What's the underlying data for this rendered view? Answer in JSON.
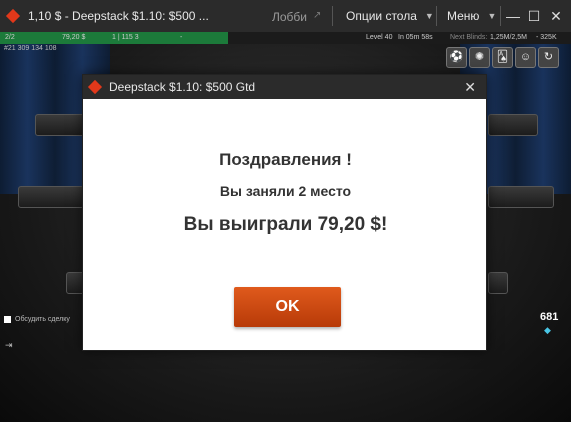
{
  "window": {
    "title": "1,10 $ - Deepstack $1.10: $500 ...",
    "lobby_label": "Лобби",
    "table_options_label": "Опции стола",
    "menu_label": "Меню"
  },
  "status": {
    "players": "2/2",
    "stack": "79,20 $",
    "level_info": "1 | 115 3",
    "plus": "-",
    "level": "Level 40",
    "time": "In 05m 58s",
    "next_blinds": "Next Blinds:",
    "blinds_value": "1,25M/2,5M",
    "ante": "- 325K",
    "hand_id": "#21 309 134 108"
  },
  "table": {
    "chat_label": "Обсудить сделку",
    "score": "681"
  },
  "dialog": {
    "title": "Deepstack $1.10: $500 Gtd",
    "congrats": "Поздравления !",
    "place": "Вы заняли 2 место",
    "won": "Вы выиграли 79,20 $!",
    "ok_label": "OK"
  },
  "icons": {
    "logo": "pokerstars-logo-icon",
    "close": "close-icon",
    "minimize": "minimize-icon",
    "maximize": "maximize-icon",
    "chevron": "chevron-down-icon",
    "diamond": "diamond-icon"
  },
  "colors": {
    "accent_orange": "#d14a10",
    "status_green": "#1c7a3a",
    "titlebar": "#2b2b2b"
  }
}
